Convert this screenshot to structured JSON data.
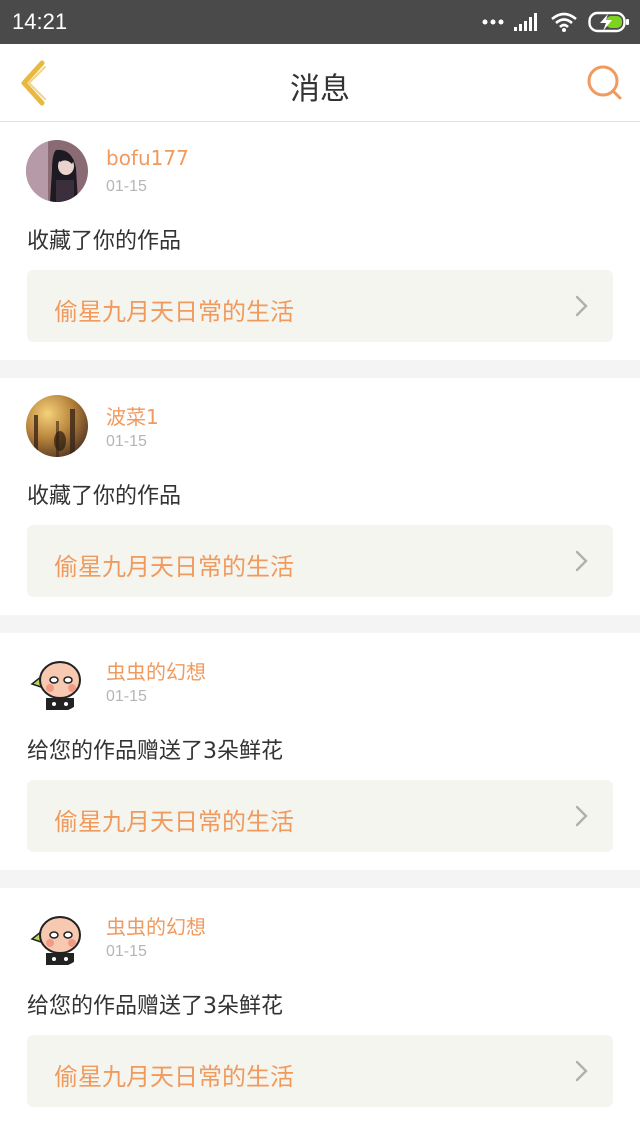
{
  "status_bar": {
    "time": "14:21"
  },
  "header": {
    "title": "消息"
  },
  "messages": [
    {
      "username": "bofu177",
      "date": "01-15",
      "action": "收藏了你的作品",
      "work_title": "偷星九月天日常的生活"
    },
    {
      "username": "波菜1",
      "date": "01-15",
      "action": "收藏了你的作品",
      "work_title": "偷星九月天日常的生活"
    },
    {
      "username": "虫虫的幻想",
      "date": "01-15",
      "action": "给您的作品赠送了3朵鲜花",
      "work_title": "偷星九月天日常的生活"
    },
    {
      "username": "虫虫的幻想",
      "date": "01-15",
      "action": "给您的作品赠送了3朵鲜花",
      "work_title": "偷星九月天日常的生活"
    }
  ],
  "colors": {
    "accent": "#f09a5e",
    "back_arrow": "#e8b840",
    "status_bar": "#4a4a4a"
  }
}
